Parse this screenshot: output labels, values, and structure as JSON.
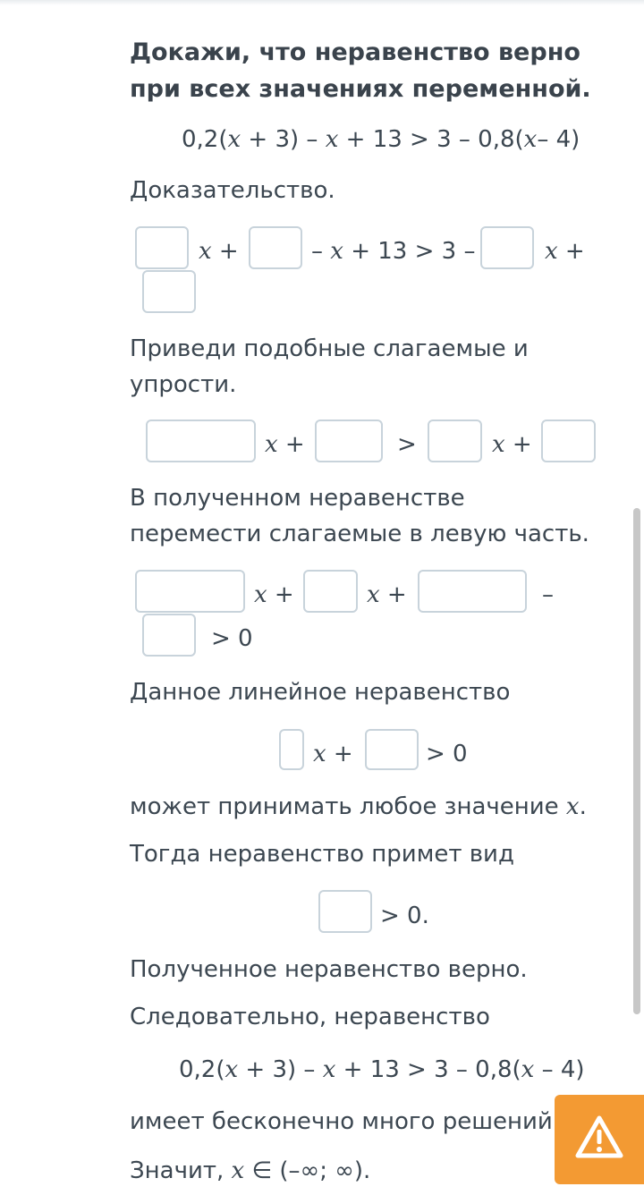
{
  "task": {
    "title_lines": [
      "Докажи, что неравенство верно",
      "при всех значениях переменной."
    ],
    "inequality": {
      "a": "0,2(",
      "x": "x",
      "b": " + 3) – ",
      "c": " + 13 > 3 – 0,8(",
      "d": "– 4)"
    }
  },
  "proof": {
    "heading": "Доказательство.",
    "step1": {
      "x": "x",
      "plus": " +",
      "minus": "–",
      "mid": " + 13 > 3 –",
      "tail": " +"
    },
    "reduce_lines": [
      "Приведи подобные слагаемые и",
      "упрости."
    ],
    "step2": {
      "x": "x",
      "plus": " +",
      "gt": ">"
    },
    "move_lines": [
      "В полученном неравенстве",
      "перемести слагаемые в левую часть."
    ],
    "step3": {
      "x": "x",
      "plus": " +",
      "minus": "–",
      "gt0": "> 0"
    },
    "linear_text": "Данное линейное неравенство",
    "step4": {
      "x": "x",
      "plus": " +",
      "gt0": "> 0"
    },
    "any_value": {
      "text": "может принимать любое значение ",
      "x": "x",
      "dot": "."
    },
    "then_text": "Тогда неравенство примет вид",
    "step5": {
      "gt0": "> 0."
    },
    "true_text": "Полученное неравенство верно.",
    "therefore_text": "Следовательно, неравенство",
    "final_ineq": {
      "a": "0,2(",
      "x": "x",
      "b": " + 3) – ",
      "c": " + 13 > 3 – 0,8(",
      "d": " – 4)"
    },
    "infinite_text": "имеет бесконечно много решений",
    "answer": {
      "prefix": "Значит, ",
      "x": "x",
      "rest": " ∈ (–∞; ∞)."
    }
  },
  "ui": {
    "report_icon": "warning-icon",
    "accent_color": "#f39a33",
    "box_border_color": "#c8d3db"
  }
}
